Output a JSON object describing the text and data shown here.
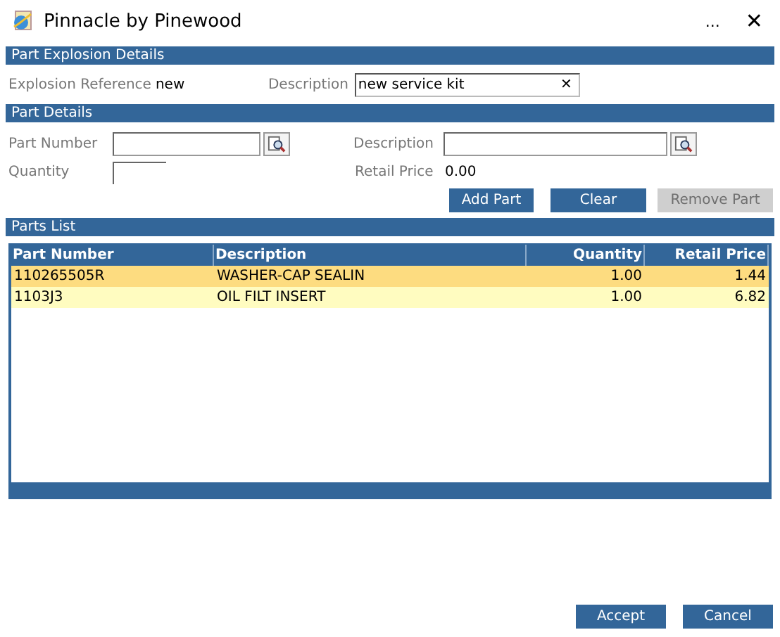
{
  "window": {
    "title": "Pinnacle by Pinewood",
    "more": "...",
    "close": "✕"
  },
  "explosion": {
    "heading": "Part Explosion Details",
    "reference_label": "Explosion Reference",
    "reference_value": "new",
    "description_label": "Description",
    "description_value": "new service kit",
    "clear_icon": "✕"
  },
  "part_details": {
    "heading": "Part Details",
    "part_number_label": "Part Number",
    "description_label": "Description",
    "quantity_label": "Quantity",
    "retail_price_label": "Retail Price",
    "retail_price_value": "0.00",
    "buttons": [
      {
        "label": "Add Part",
        "disabled": false
      },
      {
        "label": "Clear",
        "disabled": false
      },
      {
        "label": "Remove Part",
        "disabled": true
      }
    ]
  },
  "parts_list": {
    "heading": "Parts List",
    "columns": [
      "Part Number",
      "Description",
      "Quantity",
      "Retail Price"
    ],
    "rows": [
      {
        "selected": true,
        "cells": [
          "110265505R",
          "WASHER-CAP SEALIN",
          "1.00",
          "1.44"
        ]
      },
      {
        "selected": false,
        "cells": [
          "1103J3",
          "OIL FILT INSERT",
          "1.00",
          "6.82"
        ]
      }
    ]
  },
  "footer_buttons": [
    {
      "label": "Accept",
      "disabled": false
    },
    {
      "label": "Cancel",
      "disabled": false
    }
  ]
}
